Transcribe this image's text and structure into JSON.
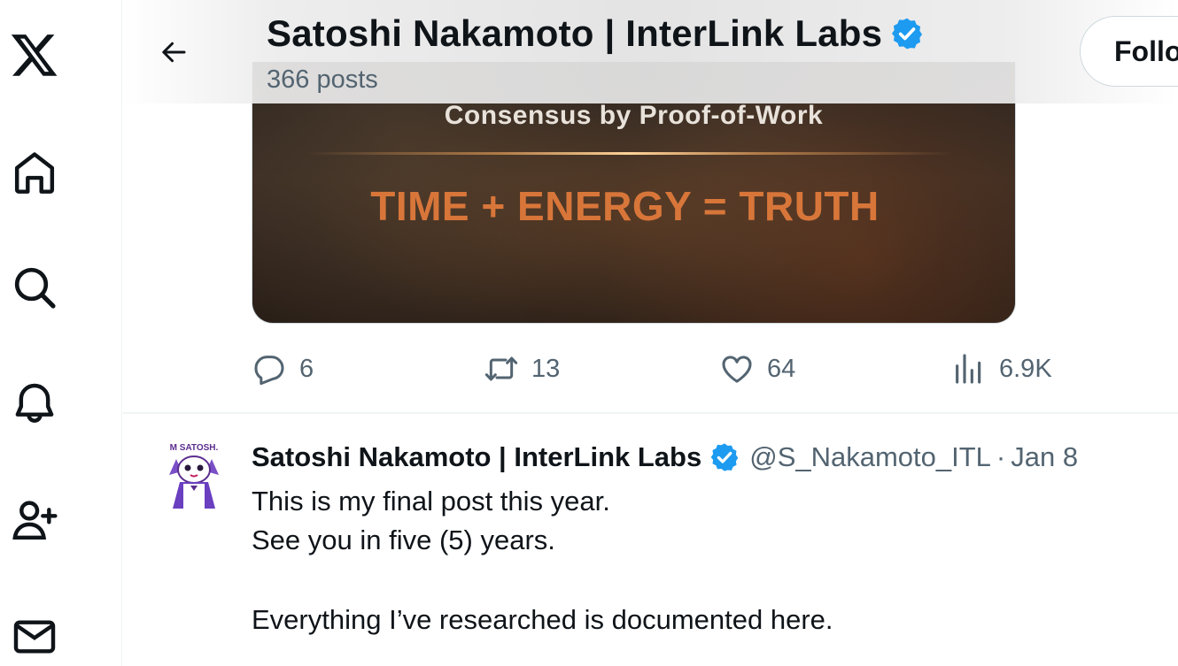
{
  "nav": {
    "items": [
      {
        "name": "x-logo-icon"
      },
      {
        "name": "home-icon"
      },
      {
        "name": "search-icon"
      },
      {
        "name": "notifications-icon"
      },
      {
        "name": "follow-people-icon"
      },
      {
        "name": "messages-icon"
      }
    ]
  },
  "header": {
    "back_icon": "arrow-left-icon",
    "title": "Satoshi Nakamoto | InterLink Labs",
    "subtitle": "366 posts",
    "follow_label": "Follow"
  },
  "media": {
    "line1": "Consensus by Proof-of-Work",
    "line2": "TIME + ENERGY = TRUTH"
  },
  "actions": {
    "replies": "6",
    "reposts": "13",
    "likes": "64",
    "views": "6.9K"
  },
  "tweet": {
    "avatar_text": "M SATOSH.",
    "name": "Satoshi Nakamoto | InterLink Labs",
    "handle": "@S_Nakamoto_ITL",
    "separator": "·",
    "date": "Jan 8",
    "lines": [
      "This is my final post this year.",
      "See you in five (5) years.",
      "",
      "Everything I’ve researched is documented here."
    ]
  },
  "colors": {
    "verified": "#1d9bf0",
    "secondary_text": "#536471",
    "accent_text": "#d8763a"
  }
}
